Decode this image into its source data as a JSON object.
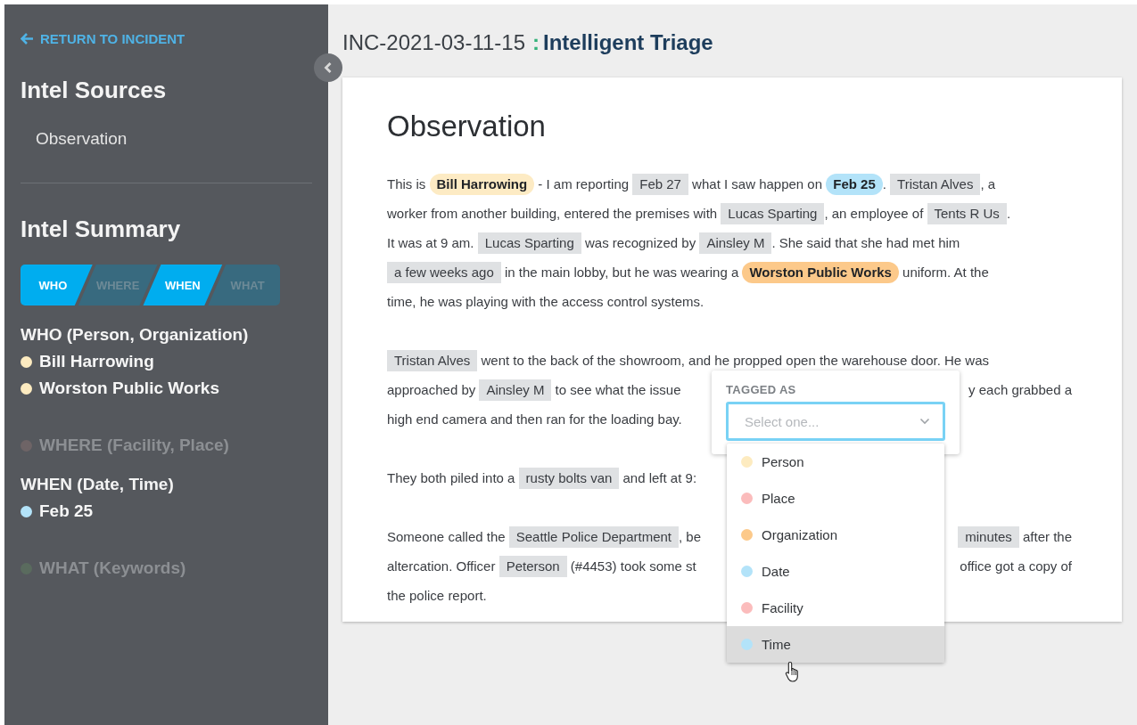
{
  "sidebar": {
    "return_link": "RETURN TO INCIDENT",
    "sources_title": "Intel Sources",
    "sources": [
      {
        "label": "Observation"
      }
    ],
    "summary_title": "Intel Summary",
    "filters": [
      {
        "label": "WHO",
        "selected": true
      },
      {
        "label": "WHERE",
        "selected": false
      },
      {
        "label": "WHEN",
        "selected": true
      },
      {
        "label": "WHAT",
        "selected": false
      }
    ],
    "sections": [
      {
        "heading": "WHO (Person, Organization)",
        "kind": "filled",
        "items": [
          {
            "label": "Bill Harrowing",
            "color": "#fdebc0"
          },
          {
            "label": "Worston Public Works",
            "color": "#fdebc0"
          }
        ]
      },
      {
        "heading": "WHERE (Facility, Place)",
        "kind": "empty",
        "color": "#6e6466"
      },
      {
        "heading": "WHEN (Date, Time)",
        "kind": "filled",
        "items": [
          {
            "label": "Feb 25",
            "color": "#b3e3f9"
          }
        ]
      },
      {
        "heading": "WHAT (Keywords)",
        "kind": "empty",
        "color": "#5a6b5e"
      }
    ]
  },
  "header": {
    "id": "INC-2021-03-11-15",
    "separator": ":",
    "title": "Intelligent Triage"
  },
  "card": {
    "title": "Observation",
    "paragraphs": [
      {
        "lines": [
          {
            "segments": [
              {
                "text": "This is "
              },
              {
                "tag": "Bill Harrowing",
                "color": "#fdebc4"
              },
              {
                "text": " - I am reporting "
              },
              {
                "tag": "Feb 27"
              },
              {
                "text": " what I saw happen on "
              },
              {
                "tag": "Feb 25",
                "color": "#b3e3f9"
              },
              {
                "text": ". "
              },
              {
                "tag": "Tristan Alves"
              },
              {
                "text": ", a"
              }
            ]
          },
          {
            "segments": [
              {
                "text": "worker from another building, entered the premises with "
              },
              {
                "tag": "Lucas Sparting"
              },
              {
                "text": ", an employee of "
              },
              {
                "tag": "Tents R Us"
              },
              {
                "text": "."
              }
            ]
          },
          {
            "segments": [
              {
                "text": "It was at 9 am. "
              },
              {
                "tag": "Lucas Sparting"
              },
              {
                "text": " was recognized by "
              },
              {
                "tag": "Ainsley M"
              },
              {
                "text": ". She said that she had met him"
              }
            ]
          },
          {
            "segments": [
              {
                "tag": "a few weeks ago"
              },
              {
                "text": " in the main lobby, but he was wearing a "
              },
              {
                "tag": "Worston Public Works",
                "color": "#fcc98a"
              },
              {
                "text": " uniform. At the"
              }
            ]
          },
          {
            "segments": [
              {
                "text": "time, he was playing with the access control systems."
              }
            ]
          }
        ]
      },
      {
        "lines": [
          {
            "segments": [
              {
                "tag": "Tristan Alves"
              },
              {
                "text": " went to the back of the showroom, and he propped open the warehouse door. He was"
              }
            ]
          },
          {
            "segments": [
              {
                "text": "approached by "
              },
              {
                "tag": "Ainsley M"
              },
              {
                "text": " to see what the issue"
              }
            ],
            "right": [
              {
                "text": "y each grabbed a"
              }
            ]
          },
          {
            "segments": [
              {
                "text": "high end camera and then ran for the loading bay."
              }
            ]
          }
        ]
      },
      {
        "lines": [
          {
            "segments": [
              {
                "text": "They both piled into a "
              },
              {
                "tag": "rusty bolts van"
              },
              {
                "text": " and left at 9:"
              }
            ]
          }
        ]
      },
      {
        "lines": [
          {
            "segments": [
              {
                "text": "Someone called the "
              },
              {
                "tag": "Seattle Police Department"
              },
              {
                "text": ", be"
              }
            ],
            "right": [
              {
                "tag": "minutes"
              },
              {
                "text": " after the"
              }
            ]
          },
          {
            "segments": [
              {
                "text": "altercation. Officer "
              },
              {
                "tag": "Peterson"
              },
              {
                "text": " (#4453) took some st"
              }
            ],
            "right": [
              {
                "text": "office got a copy of"
              }
            ]
          },
          {
            "segments": [
              {
                "text": "the police report."
              }
            ]
          }
        ]
      }
    ]
  },
  "tag_popup": {
    "label": "TAGGED AS",
    "placeholder": "Select one...",
    "options": [
      {
        "label": "Person",
        "color": "#fdebc0",
        "hovered": false
      },
      {
        "label": "Place",
        "color": "#fbbcbc",
        "hovered": false
      },
      {
        "label": "Organization",
        "color": "#fcc98a",
        "hovered": false
      },
      {
        "label": "Date",
        "color": "#b3e3f9",
        "hovered": false
      },
      {
        "label": "Facility",
        "color": "#fbbcbc",
        "hovered": false
      },
      {
        "label": "Time",
        "color": "#b3e3f9",
        "hovered": true
      }
    ]
  }
}
